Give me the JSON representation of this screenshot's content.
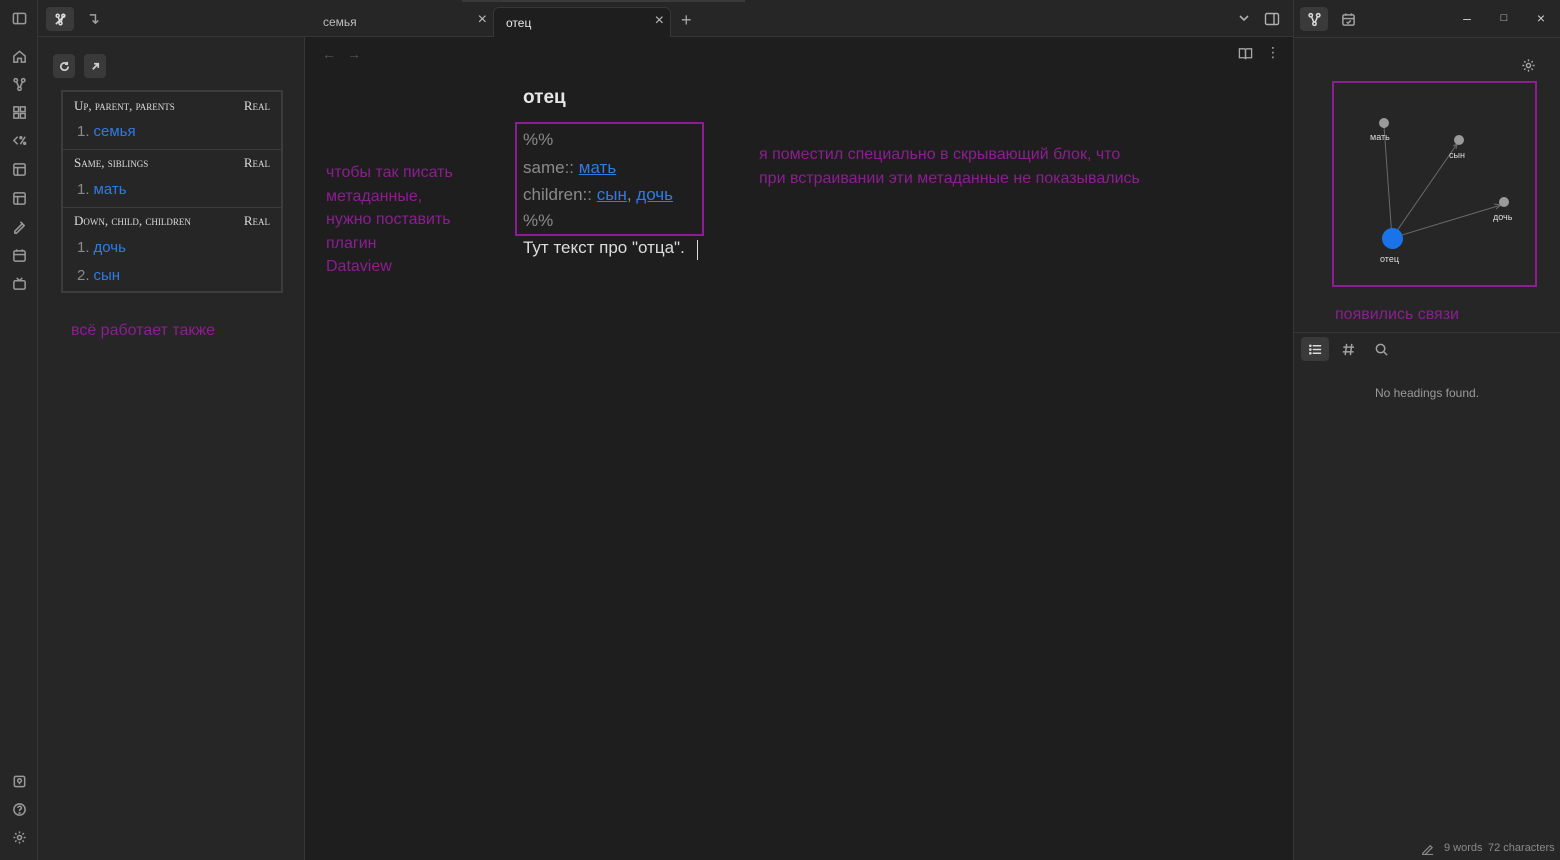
{
  "tabs": [
    {
      "label": "семья"
    },
    {
      "label": "отец"
    }
  ],
  "matrix": {
    "real_label": "Real",
    "groups": [
      {
        "title": "Up, parent, parents",
        "items": [
          "семья"
        ]
      },
      {
        "title": "Same, siblings",
        "items": [
          "мать"
        ]
      },
      {
        "title": "Down, child, children",
        "items": [
          "дочь",
          "сын"
        ]
      }
    ]
  },
  "annotations": {
    "left_sidebar": "всё работает также",
    "dataview": [
      "чтобы так писать",
      "метаданные,",
      "нужно поставить",
      "плагин",
      "Dataview"
    ],
    "hidden_block": [
      "я поместил специально в скрывающий блок, что",
      "при встраивании эти метаданные не показывались"
    ],
    "graph": "появились связи"
  },
  "note": {
    "title": "отец",
    "comment_open": "%%",
    "same_key": "same::",
    "same_link": "мать",
    "children_key": "children::",
    "children_link_1": "сын",
    "children_sep": ",",
    "children_link_2": "дочь",
    "comment_close": "%%",
    "body": "Тут текст про \"отца\"."
  },
  "graph": {
    "nodes": [
      {
        "label": "мать"
      },
      {
        "label": "сын"
      },
      {
        "label": "дочь"
      },
      {
        "label": "отец"
      }
    ],
    "active_color": "#1a73e8"
  },
  "outline": {
    "empty": "No headings found."
  },
  "status": {
    "words": "9 words",
    "chars": "72 characters"
  },
  "numbers": [
    "1.",
    "1.",
    "1.",
    "2."
  ],
  "tab_new": "+",
  "colors": {
    "accent_purple": "#8d1d92",
    "link_blue": "#2f7be6"
  }
}
